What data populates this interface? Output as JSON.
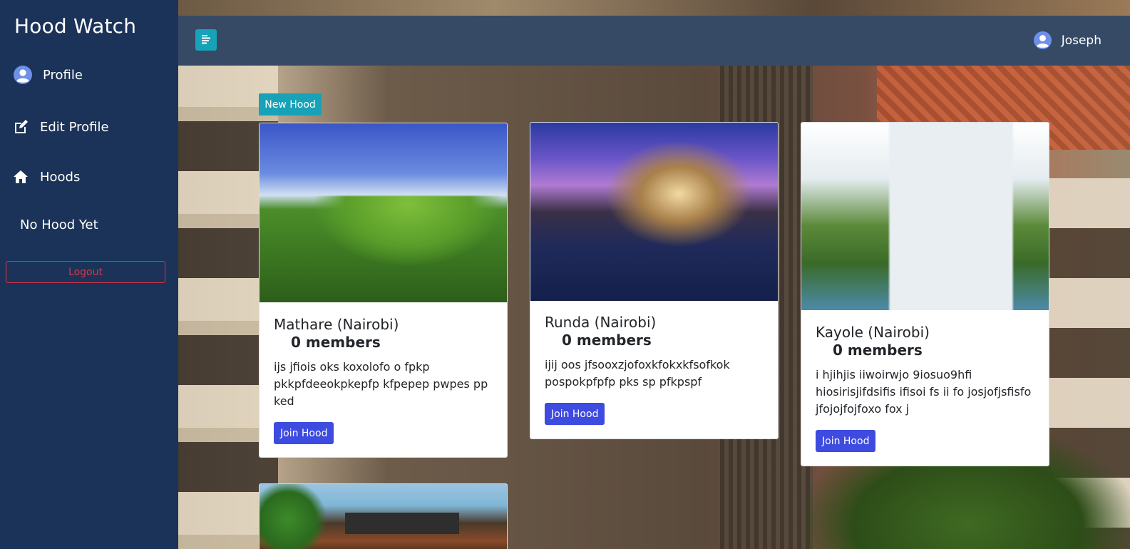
{
  "sidebar": {
    "brand": "Hood Watch",
    "items": [
      {
        "label": "Profile",
        "icon": "user-circle-icon"
      },
      {
        "label": "Edit Profile",
        "icon": "edit-icon"
      },
      {
        "label": "Hoods",
        "icon": "home-icon"
      }
    ],
    "no_hood": "No Hood Yet",
    "logout": "Logout"
  },
  "topbar": {
    "toggle_icon": "align-left-icon",
    "user_name": "Joseph"
  },
  "actions": {
    "new_hood": "New Hood"
  },
  "hoods": [
    {
      "title": "Mathare (Nairobi)",
      "members": "0 members",
      "description": "ijs jfiois oks koxolofo o fpkp pkkpfdeeokpkepfp kfpepep pwpes pp ked",
      "button": "Join Hood"
    },
    {
      "title": "Runda (Nairobi)",
      "members": "0 members",
      "description": "ijij oos jfsooxzjofoxkfokxkfsofkok pospokpfpfp pks sp pfkpspf",
      "button": "Join Hood"
    },
    {
      "title": "Kayole (Nairobi)",
      "members": "0 members",
      "description": "i hjihjis iiwoirwjo 9iosuo9hfi hiosirisjifdsifis ifisoi fs ii fo josjofjsfisfo jfojojfojfoxo fox j",
      "button": "Join Hood"
    }
  ],
  "colors": {
    "sidebar_bg": "#1b3358",
    "topbar_bg": "#364a66",
    "accent_teal": "#17a2b8",
    "join_blue": "#3d4be0",
    "logout_red": "#dc3545",
    "avatar_blue": "#6f8fe8"
  }
}
